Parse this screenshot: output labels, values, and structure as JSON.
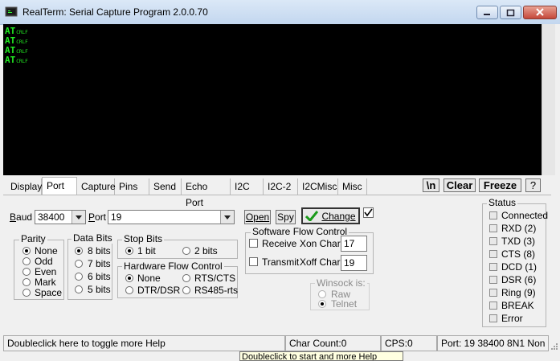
{
  "window": {
    "title": "RealTerm: Serial Capture Program 2.0.0.70"
  },
  "terminal": {
    "lines": [
      {
        "text": "AT",
        "eol": "CRLF"
      },
      {
        "text": "AT",
        "eol": "CRLF"
      },
      {
        "text": "AT",
        "eol": "CRLF"
      },
      {
        "text": "AT",
        "eol": "CRLF"
      }
    ]
  },
  "tabs": [
    "Display",
    "Port",
    "Capture",
    "Pins",
    "Send",
    "Echo Port",
    "I2C",
    "I2C-2",
    "I2CMisc",
    "Misc"
  ],
  "toolbar": {
    "newline_label": "\\n",
    "clear_label": "Clear",
    "freeze_label": "Freeze",
    "help_label": "?"
  },
  "port": {
    "baud_label": "Baud",
    "baud_value": "38400",
    "port_label": "Port",
    "port_value": "19",
    "open_label": "Open",
    "spy_label": "Spy",
    "change_label": "Change"
  },
  "parity": {
    "title": "Parity",
    "options": [
      "None",
      "Odd",
      "Even",
      "Mark",
      "Space"
    ],
    "selected": "None"
  },
  "data_bits": {
    "title": "Data Bits",
    "options": [
      "8 bits",
      "7 bits",
      "6 bits",
      "5 bits"
    ],
    "selected": "8 bits"
  },
  "stop_bits": {
    "title": "Stop Bits",
    "options": [
      "1 bit",
      "2 bits"
    ],
    "selected": "1 bit"
  },
  "hw_flow": {
    "title": "Hardware Flow Control",
    "options": [
      "None",
      "RTS/CTS",
      "DTR/DSR",
      "RS485-rts"
    ],
    "selected": "None"
  },
  "sw_flow": {
    "title": "Software Flow Control",
    "receive_label": "Receive",
    "xon_label": "Xon Char:",
    "xon_value": "17",
    "transmit_label": "Transmit",
    "xoff_label": "Xoff Char:",
    "xoff_value": "19"
  },
  "winsock": {
    "title": "Winsock is:",
    "options": [
      "Raw",
      "Telnet"
    ],
    "selected": "Telnet"
  },
  "status": {
    "title": "Status",
    "items": [
      "Connected",
      "RXD (2)",
      "TXD (3)",
      "CTS (8)",
      "DCD (1)",
      "DSR (6)",
      "Ring (9)",
      "BREAK",
      "Error"
    ]
  },
  "statusbar": {
    "help": "Doubleclick here to toggle more Help",
    "char_count": "Char Count:0",
    "cps": "CPS:0",
    "port_info": "Port: 19 38400 8N1 Non"
  },
  "tooltip": {
    "text": "Doubleclick to start and more Help"
  }
}
